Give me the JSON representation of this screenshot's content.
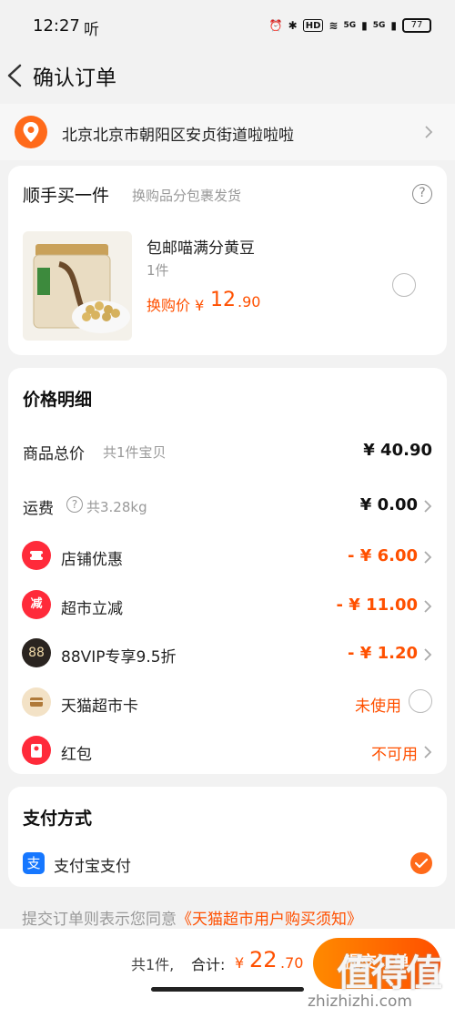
{
  "status_bar": {
    "time": "12:27",
    "signal_label": "听",
    "hd_label": "HD",
    "net1": "5G",
    "net2": "5G",
    "battery": "77"
  },
  "nav": {
    "title": "确认订单"
  },
  "address": {
    "text": "北京北京市朝阳区安贞街道啦啦啦"
  },
  "addon": {
    "title": "顺手买一件",
    "subtitle": "换购品分包裹发货",
    "help": "?",
    "product": {
      "name": "包邮喵满分黄豆",
      "qty": "1件",
      "price_label": "换购价 ¥",
      "price_main": "12",
      "price_decimal": ".90"
    }
  },
  "price_detail": {
    "title": "价格明细",
    "rows": [
      {
        "label": "商品总价",
        "sub": "共1件宝贝",
        "value": "¥ 40.90"
      },
      {
        "label": "运费",
        "sub": "共3.28kg",
        "value": "¥ 0.00"
      },
      {
        "label": "店铺优惠",
        "sub": "",
        "value": "- ¥ 6.00",
        "icon": "coupon-icon"
      },
      {
        "label": "超市立减",
        "sub": "",
        "value": "- ¥ 11.00",
        "icon": "discount-icon",
        "icon_text": "减"
      },
      {
        "label": "88VIP专享9.5折",
        "sub": "",
        "value": "- ¥ 1.20",
        "icon": "vip-88-icon",
        "icon_text": "88"
      },
      {
        "label": "天猫超市卡",
        "sub": "",
        "value": "未使用",
        "icon": "card-icon"
      },
      {
        "label": "红包",
        "sub": "",
        "value": "不可用",
        "icon": "red-packet-icon"
      }
    ]
  },
  "payment": {
    "title": "支付方式",
    "method_icon_text": "支",
    "method": "支付宝支付"
  },
  "agreement": {
    "prefix": "提交订单则表示您同意",
    "link": "《天猫超市用户购买须知》"
  },
  "bottom": {
    "count": "共1件,",
    "total_label": "合计:",
    "total_yen": "¥",
    "total_main": "22",
    "total_decimal": ".70",
    "submit": "提交订单"
  },
  "watermark": {
    "logo": "值得值",
    "url": "zhizhizhi.com"
  },
  "colors": {
    "accent": "#ff5000",
    "alipay": "#1677ff",
    "background": "#f2f2f2"
  }
}
